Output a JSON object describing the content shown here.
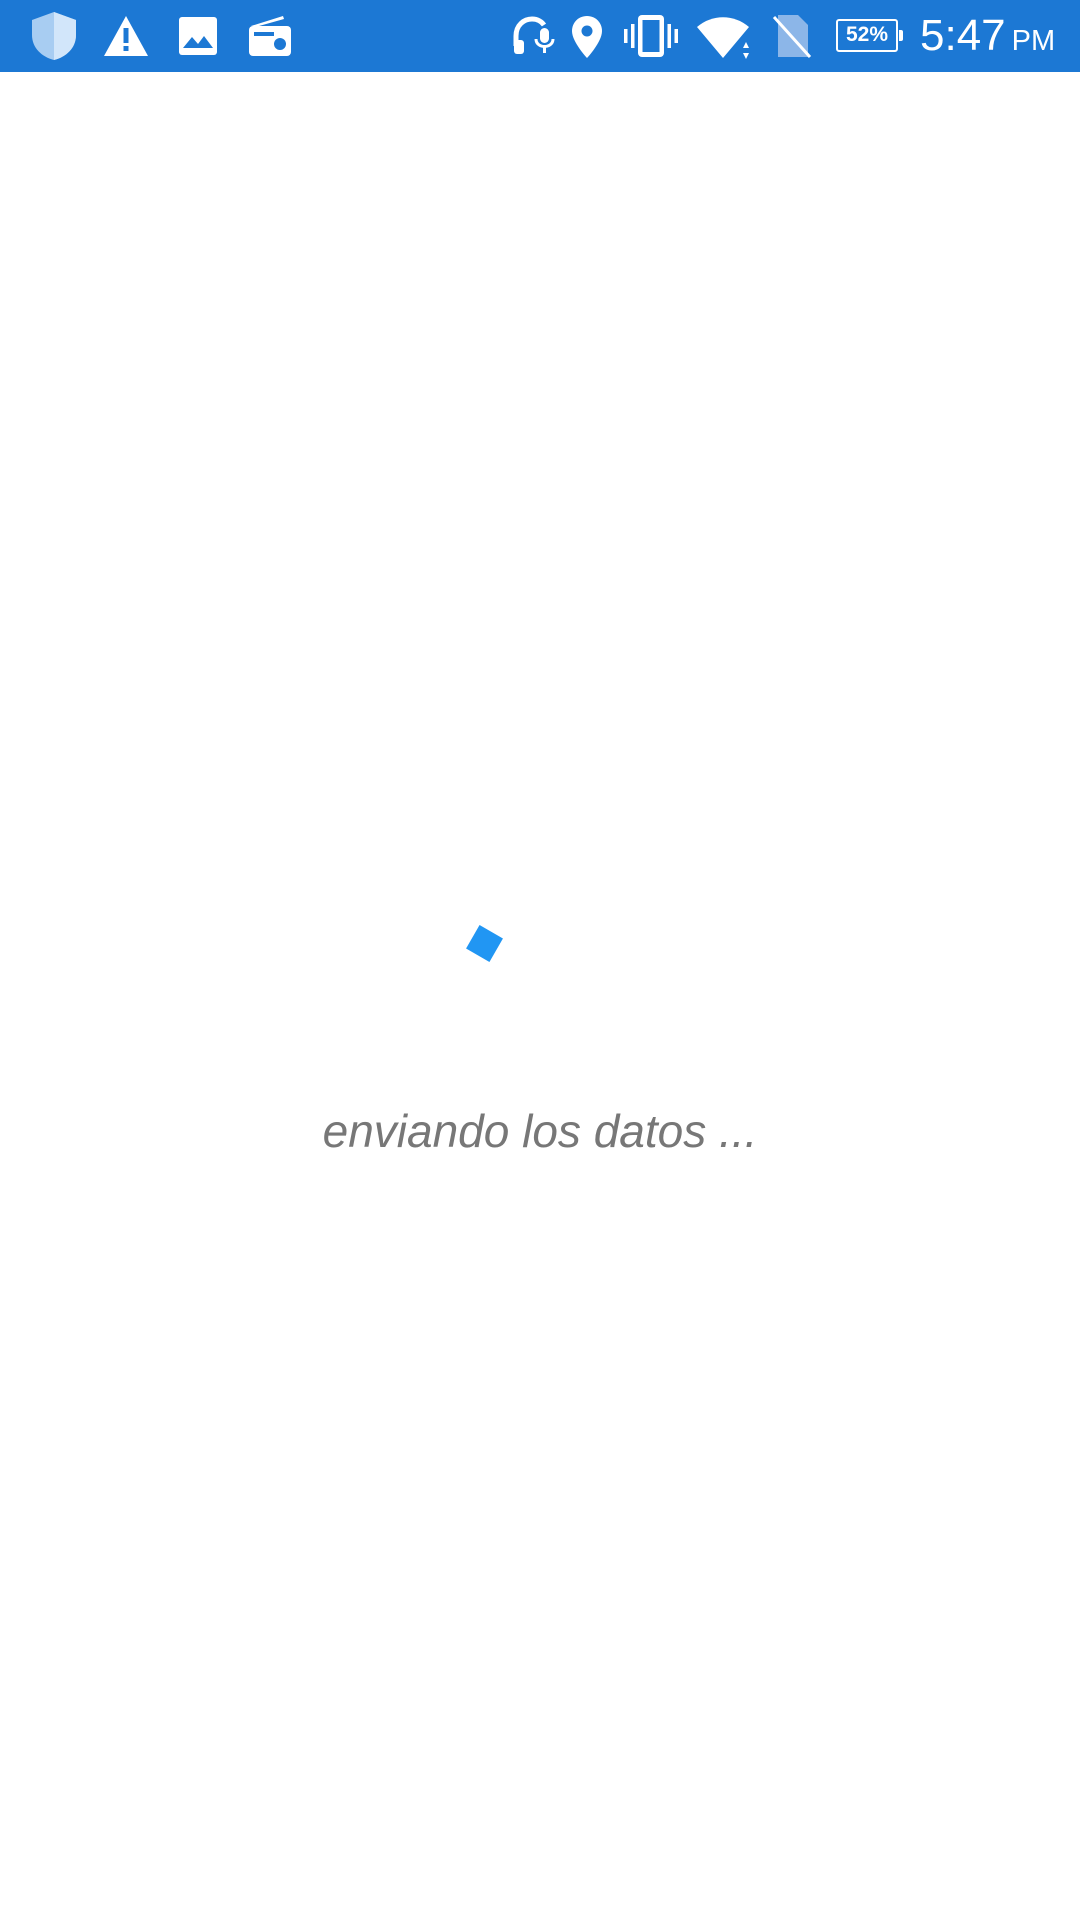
{
  "status_bar": {
    "background_color": "#1c78d4",
    "left_icons": [
      "shield-icon",
      "warning-icon",
      "image-icon",
      "radio-icon"
    ],
    "right_icons": [
      "headset-mic-icon",
      "location-icon",
      "vibrate-icon",
      "wifi-icon",
      "no-sim-icon",
      "battery-icon"
    ],
    "battery_percent": "52%",
    "time": "5:47",
    "ampm": "PM"
  },
  "main": {
    "loader_color": "#2196f3",
    "loading_text": "enviando los datos ..."
  }
}
